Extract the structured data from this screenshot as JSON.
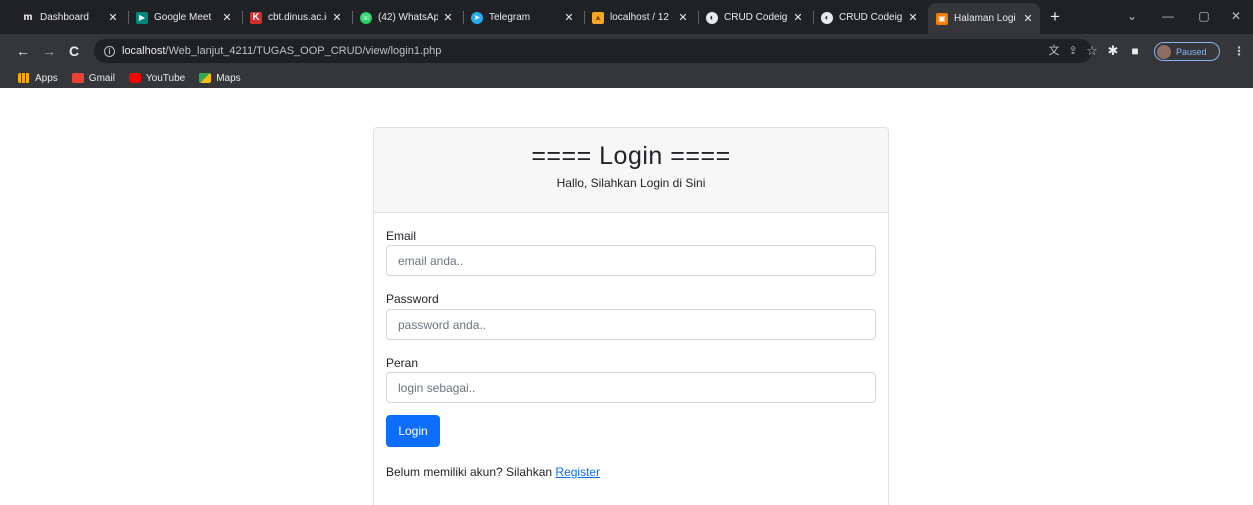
{
  "browser": {
    "tabs": [
      {
        "title": "Dashboard",
        "icon": "m-logo-icon",
        "color": "#202124"
      },
      {
        "title": "Google Meet",
        "icon": "meet-icon",
        "color": "#00897b"
      },
      {
        "title": "cbt.dinus.ac.id",
        "icon": "k-logo-icon",
        "color": "#d32f2f"
      },
      {
        "title": "(42) WhatsApp",
        "icon": "whatsapp-icon",
        "color": "#25d366"
      },
      {
        "title": "Telegram",
        "icon": "telegram-icon",
        "color": "#2aabee"
      },
      {
        "title": "localhost / 12",
        "icon": "phpmyadmin-icon",
        "color": "#f5a623"
      },
      {
        "title": "CRUD Codeig",
        "icon": "globe-icon",
        "color": "#e8eaed"
      },
      {
        "title": "CRUD Codeig",
        "icon": "globe-icon",
        "color": "#e8eaed"
      },
      {
        "title": "Halaman Logi",
        "icon": "page-icon",
        "color": "#f57c00"
      }
    ],
    "url_host": "localhost",
    "url_path": "/Web_lanjut_4211/TUGAS_OOP_CRUD/view/login1.php",
    "profile_label": "Paused",
    "bookmarks": [
      {
        "label": "Apps",
        "icon": "apps-grid-icon",
        "color": "#f9ab00"
      },
      {
        "label": "Gmail",
        "icon": "gmail-icon",
        "color": "#ea4335"
      },
      {
        "label": "YouTube",
        "icon": "youtube-icon",
        "color": "#ff0000"
      },
      {
        "label": "Maps",
        "icon": "maps-icon",
        "color": "#34a853"
      }
    ]
  },
  "login": {
    "title": "==== Login ====",
    "subtitle": "Hallo, Silahkan Login di Sini",
    "email_label": "Email",
    "email_placeholder": "email anda..",
    "password_label": "Password",
    "password_placeholder": "password anda..",
    "role_label": "Peran",
    "role_placeholder": "login sebagai..",
    "button_label": "Login",
    "footer_text": "Belum memiliki akun? Silahkan ",
    "register_link": "Register"
  },
  "colors": {
    "primary": "#0d6efd",
    "chrome_dark": "#202124",
    "chrome_toolbar": "#35363a"
  }
}
